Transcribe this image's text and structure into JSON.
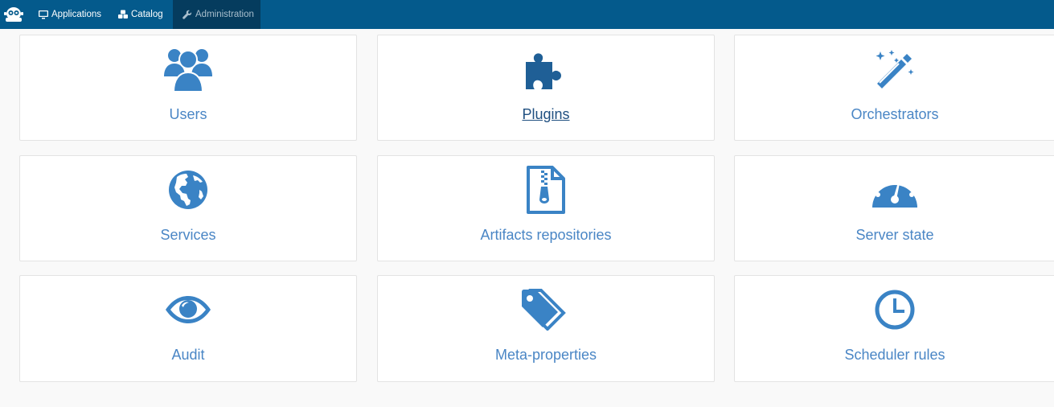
{
  "nav": {
    "items": [
      {
        "label": "Applications",
        "icon": "monitor-icon"
      },
      {
        "label": "Catalog",
        "icon": "cubes-icon"
      },
      {
        "label": "Administration",
        "icon": "wrench-icon"
      }
    ]
  },
  "tiles": [
    {
      "label": "Users",
      "icon": "users-icon"
    },
    {
      "label": "Plugins",
      "icon": "puzzle-icon"
    },
    {
      "label": "Orchestrators",
      "icon": "magic-wand-icon"
    },
    {
      "label": "Services",
      "icon": "globe-icon"
    },
    {
      "label": "Artifacts repositories",
      "icon": "zip-file-icon"
    },
    {
      "label": "Server state",
      "icon": "dashboard-icon"
    },
    {
      "label": "Audit",
      "icon": "eye-icon"
    },
    {
      "label": "Meta-properties",
      "icon": "tags-icon"
    },
    {
      "label": "Scheduler rules",
      "icon": "clock-icon"
    }
  ],
  "colors": {
    "topbar": "#045a8c",
    "accent": "#4a86c5",
    "icon": "#3a83c5",
    "icon_dark": "#1f5f96"
  }
}
